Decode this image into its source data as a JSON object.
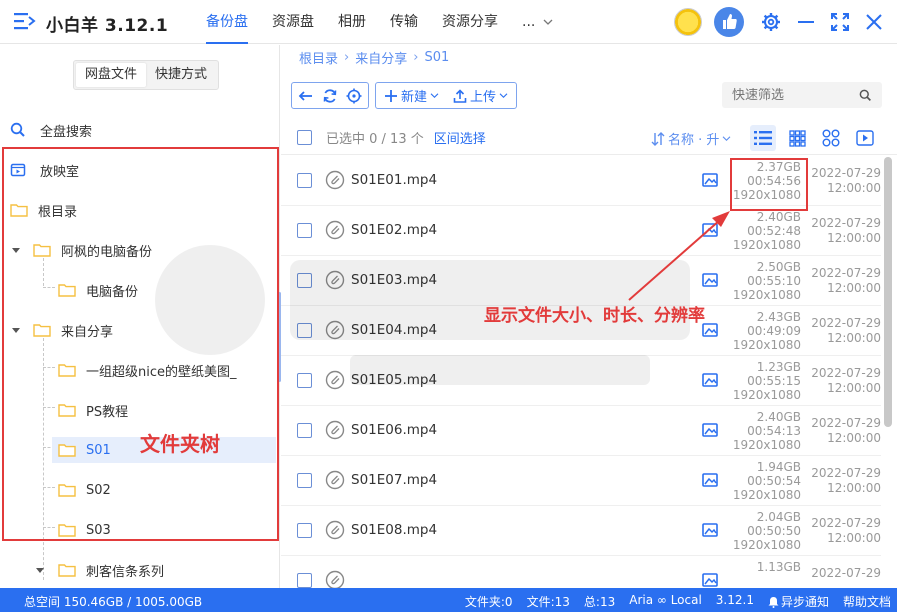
{
  "app": {
    "title": "小白羊 3.12.1"
  },
  "nav": {
    "items": [
      "备份盘",
      "资源盘",
      "相册",
      "传输",
      "资源分享"
    ],
    "active": 0,
    "more": "..."
  },
  "sidebar": {
    "segments": [
      "网盘文件",
      "快捷方式"
    ],
    "links": [
      {
        "label": "全盘搜索",
        "icon": "search-icon"
      },
      {
        "label": "放映室",
        "icon": "screening-room-icon"
      }
    ],
    "tree": [
      {
        "label": "根目录",
        "level": 0
      },
      {
        "label": "阿枫的电脑备份",
        "level": 0
      },
      {
        "label": "电脑备份",
        "level": 1
      },
      {
        "label": "来自分享",
        "level": 0
      },
      {
        "label": "一组超级nice的壁纸美图_",
        "level": 1
      },
      {
        "label": "PS教程",
        "level": 1
      },
      {
        "label": "S01",
        "level": 1
      },
      {
        "label": "S02",
        "level": 1
      },
      {
        "label": "S03",
        "level": 1
      },
      {
        "label": "刺客信条系列",
        "level": 1
      }
    ],
    "annotation": "文件夹树"
  },
  "main": {
    "breadcrumb": [
      "根目录",
      "来自分享",
      "S01"
    ],
    "toolbar": {
      "new_label": "新建",
      "upload_label": "上传"
    },
    "filter": {
      "placeholder": "快速筛选"
    },
    "list_header": {
      "selected": "已选中 0 / 13 个",
      "range_select": "区间选择",
      "sort": "名称 · 升"
    },
    "files": [
      {
        "name": "S01E01.mp4",
        "size": "2.37GB",
        "duration": "00:54:56",
        "resolution": "1920x1080",
        "date": "2022-07-29",
        "time": "12:00:00"
      },
      {
        "name": "S01E02.mp4",
        "size": "2.40GB",
        "duration": "00:52:48",
        "resolution": "1920x1080",
        "date": "2022-07-29",
        "time": "12:00:00"
      },
      {
        "name": "S01E03.mp4",
        "size": "2.50GB",
        "duration": "00:55:10",
        "resolution": "1920x1080",
        "date": "2022-07-29",
        "time": "12:00:00"
      },
      {
        "name": "S01E04.mp4",
        "size": "2.43GB",
        "duration": "00:49:09",
        "resolution": "1920x1080",
        "date": "2022-07-29",
        "time": "12:00:00"
      },
      {
        "name": "S01E05.mp4",
        "size": "1.23GB",
        "duration": "00:55:15",
        "resolution": "1920x1080",
        "date": "2022-07-29",
        "time": "12:00:00"
      },
      {
        "name": "S01E06.mp4",
        "size": "2.40GB",
        "duration": "00:54:13",
        "resolution": "1920x1080",
        "date": "2022-07-29",
        "time": "12:00:00"
      },
      {
        "name": "S01E07.mp4",
        "size": "1.94GB",
        "duration": "00:50:54",
        "resolution": "1920x1080",
        "date": "2022-07-29",
        "time": "12:00:00"
      },
      {
        "name": "S01E08.mp4",
        "size": "2.04GB",
        "duration": "00:50:50",
        "resolution": "1920x1080",
        "date": "2022-07-29",
        "time": "12:00:00"
      },
      {
        "name": "",
        "size": "1.13GB",
        "duration": "",
        "resolution": "",
        "date": "2022-07-29",
        "time": ""
      }
    ],
    "annotation": "显示文件大小、时长、分辨率"
  },
  "statusbar": {
    "total_space": "总空间 150.46GB / 1005.00GB",
    "folders": "文件夹:0",
    "files": "文件:13",
    "total": "总:13",
    "engine": "Aria ∞ Local",
    "version": "3.12.1",
    "async_notice": "异步通知",
    "help": "帮助文档"
  },
  "colors": {
    "accent": "#2a6ff0",
    "annotation": "#e23b3b",
    "folder": "#f5c042"
  }
}
